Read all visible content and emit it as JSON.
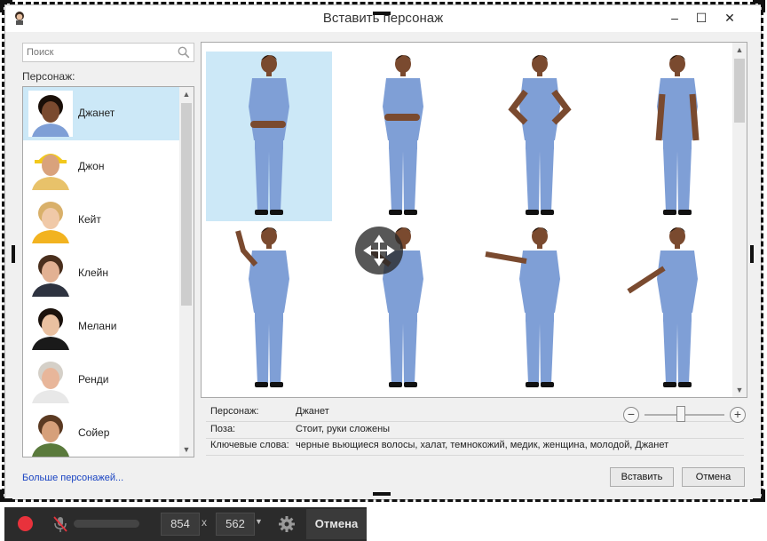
{
  "window": {
    "title": "Вставить персонаж",
    "controls": {
      "minimize": "–",
      "maximize": "☐",
      "close": "✕"
    }
  },
  "search": {
    "placeholder": "Поиск",
    "value": ""
  },
  "characters_label": "Персонаж:",
  "characters": [
    {
      "name": "Джанет",
      "selected": true,
      "skin": "#7a4a2f",
      "hair": "#1a0f08",
      "shirt": "#7f9fd6",
      "hat": ""
    },
    {
      "name": "Джон",
      "selected": false,
      "skin": "#d9a27c",
      "hair": "#5a4030",
      "shirt": "#e8c26a",
      "hat": "#f2c81c"
    },
    {
      "name": "Кейт",
      "selected": false,
      "skin": "#f0c9a8",
      "hair": "#d9b06a",
      "shirt": "#f2b320",
      "hat": ""
    },
    {
      "name": "Клейн",
      "selected": false,
      "skin": "#e2b193",
      "hair": "#4a2f1d",
      "shirt": "#2e3340",
      "hat": ""
    },
    {
      "name": "Мелани",
      "selected": false,
      "skin": "#e9c0a0",
      "hair": "#1b120c",
      "shirt": "#1a1a1a",
      "hat": ""
    },
    {
      "name": "Ренди",
      "selected": false,
      "skin": "#e8b69a",
      "hair": "#d5d0c8",
      "shirt": "#e8e8e8",
      "hat": ""
    },
    {
      "name": "Сойер",
      "selected": false,
      "skin": "#d6a07a",
      "hair": "#5b3a22",
      "shirt": "#5a7a3c",
      "hat": ""
    }
  ],
  "more_characters": "Больше персонажей...",
  "poses": [
    {
      "selected": true,
      "arms": "crossed-low",
      "look": "front"
    },
    {
      "selected": false,
      "arms": "crossed",
      "look": "left"
    },
    {
      "selected": false,
      "arms": "hips",
      "look": "front"
    },
    {
      "selected": false,
      "arms": "down",
      "look": "front"
    },
    {
      "selected": false,
      "arms": "point-up-left",
      "look": "left"
    },
    {
      "selected": false,
      "arms": "point-left",
      "look": "left"
    },
    {
      "selected": false,
      "arms": "point-left-far",
      "look": "left"
    },
    {
      "selected": false,
      "arms": "point-low-left",
      "look": "left"
    }
  ],
  "details": {
    "character_label": "Персонаж:",
    "character_value": "Джанет",
    "pose_label": "Поза:",
    "pose_value": "Стоит, руки сложены",
    "keywords_label": "Ключевые слова:",
    "keywords_value": "черные вьющиеся волосы, халат, темнокожий, медик, женщина, молодой, Джанет"
  },
  "zoom": {
    "level": 0.45
  },
  "buttons": {
    "insert": "Вставить",
    "cancel": "Отмена"
  },
  "recorder": {
    "width": "854",
    "x": "x",
    "height": "562",
    "cancel": "Отмена"
  },
  "colors": {
    "selection": "#cce8f7",
    "scrubs": "#7f9fd6",
    "record": "#e8323c",
    "link": "#1a44c2"
  }
}
